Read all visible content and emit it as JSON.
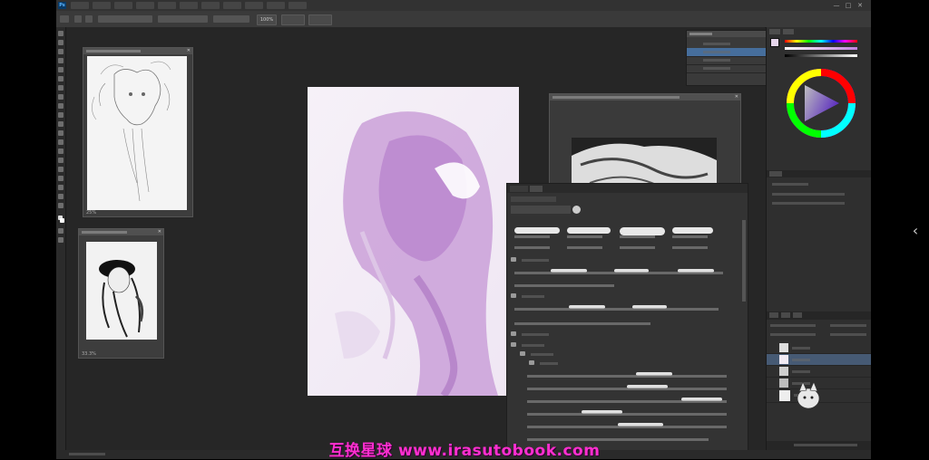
{
  "app": {
    "name": "Photoshop",
    "logo_text": "Ps"
  },
  "window_controls": {
    "minimize": "—",
    "maximize": "□",
    "close": "✕"
  },
  "menubar": {
    "items": [
      "",
      "",
      "",
      "",
      "",
      "",
      "",
      "",
      "",
      "",
      ""
    ]
  },
  "optionsbar": {
    "zoom_value": "100%",
    "fit_screen_label": "",
    "fill_screen_label": ""
  },
  "documents": [
    {
      "title": "",
      "zoom": "25%"
    },
    {
      "title": "",
      "zoom": "33.3%"
    },
    {
      "title": "",
      "zoom": ""
    }
  ],
  "colors": {
    "app_bg": "#262626",
    "panel_bg": "#2f2f2f",
    "accent": "#2a8ae6",
    "watermark": "#ff2fd0",
    "painting_tint": "#c7a0d6"
  },
  "brush_panel": {
    "tabs": [
      "",
      ""
    ],
    "folders": [
      "",
      "",
      "",
      "",
      ""
    ],
    "presets_count_rows": 10
  },
  "history_panel": {
    "title": "",
    "entries": [
      "",
      "",
      "",
      ""
    ]
  },
  "layers_panel": {
    "tabs": [
      "",
      "",
      ""
    ],
    "layers": [
      "",
      "",
      "",
      "",
      ""
    ]
  },
  "watermark": {
    "text": "互换星球 www.irasutobook.com"
  },
  "nav": {
    "next_chevron": "‹"
  },
  "icons": [
    "ps-logo-icon",
    "zoom-in-icon",
    "zoom-out-icon",
    "brush-icon",
    "eraser-icon",
    "folder-icon",
    "close-icon",
    "chevron-left-icon",
    "color-wheel-icon"
  ]
}
